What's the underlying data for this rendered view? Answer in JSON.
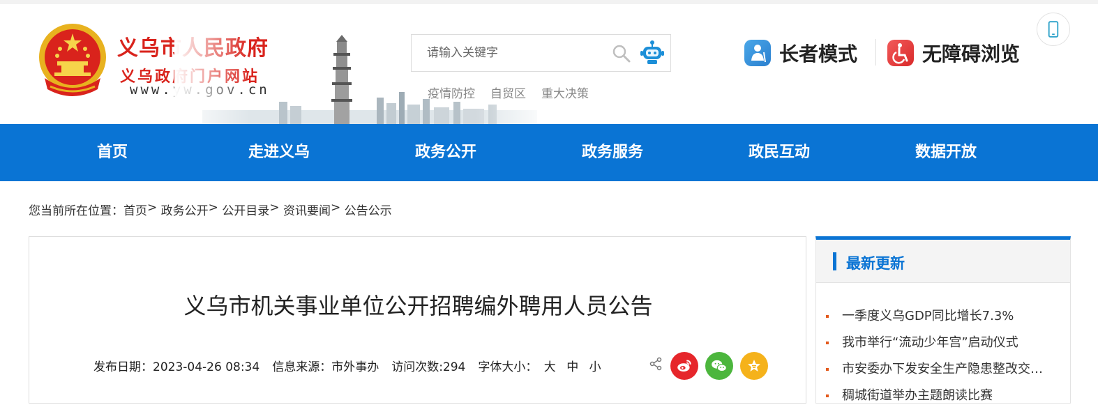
{
  "header": {
    "site_title": "义乌市人民政府",
    "site_subtitle": "义乌政府门户网站",
    "site_url": "www.yw.gov.cn",
    "search": {
      "placeholder": "请输入关键字"
    },
    "hot_links": [
      "疫情防控",
      "自贸区",
      "重大决策"
    ],
    "elder_mode_label": "长者模式",
    "accessibility_label": "无障碍浏览"
  },
  "nav": {
    "items": [
      {
        "label": "首页"
      },
      {
        "label": "走进义乌"
      },
      {
        "label": "政务公开"
      },
      {
        "label": "政务服务"
      },
      {
        "label": "政民互动"
      },
      {
        "label": "数据开放"
      }
    ]
  },
  "breadcrumb": {
    "prefix": "您当前所在位置：",
    "items": [
      "首页",
      "政务公开",
      "公开目录",
      "资讯要闻",
      "公告公示"
    ],
    "separator": ">"
  },
  "article": {
    "title": "义乌市机关事业单位公开招聘编外聘用人员公告",
    "publish_date": "发布日期：2023-04-26 08:34",
    "source": "信息来源：市外事办",
    "visits": "访问次数:294",
    "font_size_label": "字体大小：",
    "font_options": [
      "大",
      "中",
      "小"
    ]
  },
  "sidebar": {
    "title": "最新更新",
    "items": [
      "一季度义乌GDP同比增长7.3%",
      "我市举行“流动少年宫”启动仪式",
      "市安委办下发安全生产隐患整改交办单",
      "稠城街道举办主题朗读比赛"
    ]
  },
  "colors": {
    "brand_red": "#d9231c",
    "nav_blue": "#0a74d4",
    "bullet_orange": "#e35a1d"
  }
}
